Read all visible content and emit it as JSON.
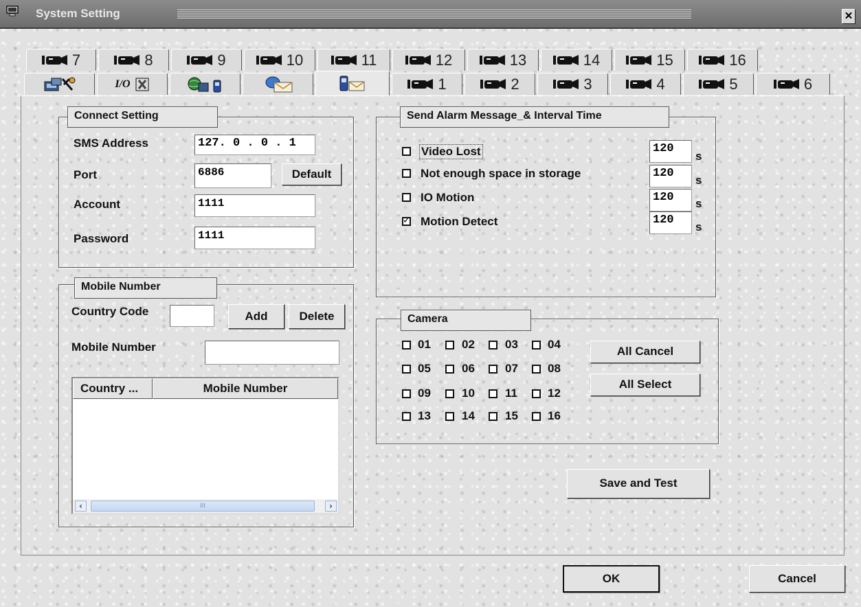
{
  "window": {
    "title": "System Setting",
    "close_glyph": "✕"
  },
  "tabs_row1": [
    {
      "icon": "camera-icon",
      "label": "7"
    },
    {
      "icon": "camera-icon",
      "label": "8"
    },
    {
      "icon": "camera-icon",
      "label": "9"
    },
    {
      "icon": "camera-icon",
      "label": "10"
    },
    {
      "icon": "camera-icon",
      "label": "11"
    },
    {
      "icon": "camera-icon",
      "label": "12"
    },
    {
      "icon": "camera-icon",
      "label": "13"
    },
    {
      "icon": "camera-icon",
      "label": "14"
    },
    {
      "icon": "camera-icon",
      "label": "15"
    },
    {
      "icon": "camera-icon",
      "label": "16"
    }
  ],
  "tabs_row2": [
    {
      "icon": "network-tools-icon",
      "label": ""
    },
    {
      "icon": "io-settings-icon",
      "label": "I/O"
    },
    {
      "icon": "globe-phone-icon",
      "label": ""
    },
    {
      "icon": "email-icon",
      "label": ""
    },
    {
      "icon": "mobile-message-icon",
      "label": "",
      "active": true
    },
    {
      "icon": "camera-icon",
      "label": "1"
    },
    {
      "icon": "camera-icon",
      "label": "2"
    },
    {
      "icon": "camera-icon",
      "label": "3"
    },
    {
      "icon": "camera-icon",
      "label": "4"
    },
    {
      "icon": "camera-icon",
      "label": "5"
    },
    {
      "icon": "camera-icon",
      "label": "6"
    }
  ],
  "connect": {
    "title": "Connect Setting",
    "sms_label": "SMS Address",
    "sms_value": "127. 0 . 0 . 1",
    "port_label": "Port",
    "port_value": "6886",
    "default_button": "Default",
    "account_label": "Account",
    "account_value": "1111",
    "password_label": "Password",
    "password_value": "1111"
  },
  "mobile": {
    "title": "Mobile Number",
    "country_code_label": "Country Code",
    "country_code_value": "",
    "add_button": "Add",
    "delete_button": "Delete",
    "mobile_label": "Mobile Number",
    "mobile_value": "",
    "columns": [
      "Country ...",
      "Mobile Number"
    ],
    "rows": [],
    "scroll_grip": "III"
  },
  "alarm": {
    "title": "Send Alarm Message_& Interval Time",
    "items": [
      {
        "label": "Video Lost",
        "checked": false,
        "interval": "120",
        "unit": "s"
      },
      {
        "label": "Not enough space in storage",
        "checked": false,
        "interval": "120",
        "unit": "s"
      },
      {
        "label": "IO Motion",
        "checked": false,
        "interval": "120",
        "unit": "s"
      },
      {
        "label": "Motion Detect",
        "checked": true,
        "interval": "120",
        "unit": "s"
      }
    ]
  },
  "camera": {
    "title": "Camera",
    "channels": [
      "01",
      "02",
      "03",
      "04",
      "05",
      "06",
      "07",
      "08",
      "09",
      "10",
      "11",
      "12",
      "13",
      "14",
      "15",
      "16"
    ],
    "all_cancel_button": "All Cancel",
    "all_select_button": "All Select"
  },
  "save_test_button": "Save and Test",
  "ok_button": "OK",
  "cancel_button": "Cancel"
}
